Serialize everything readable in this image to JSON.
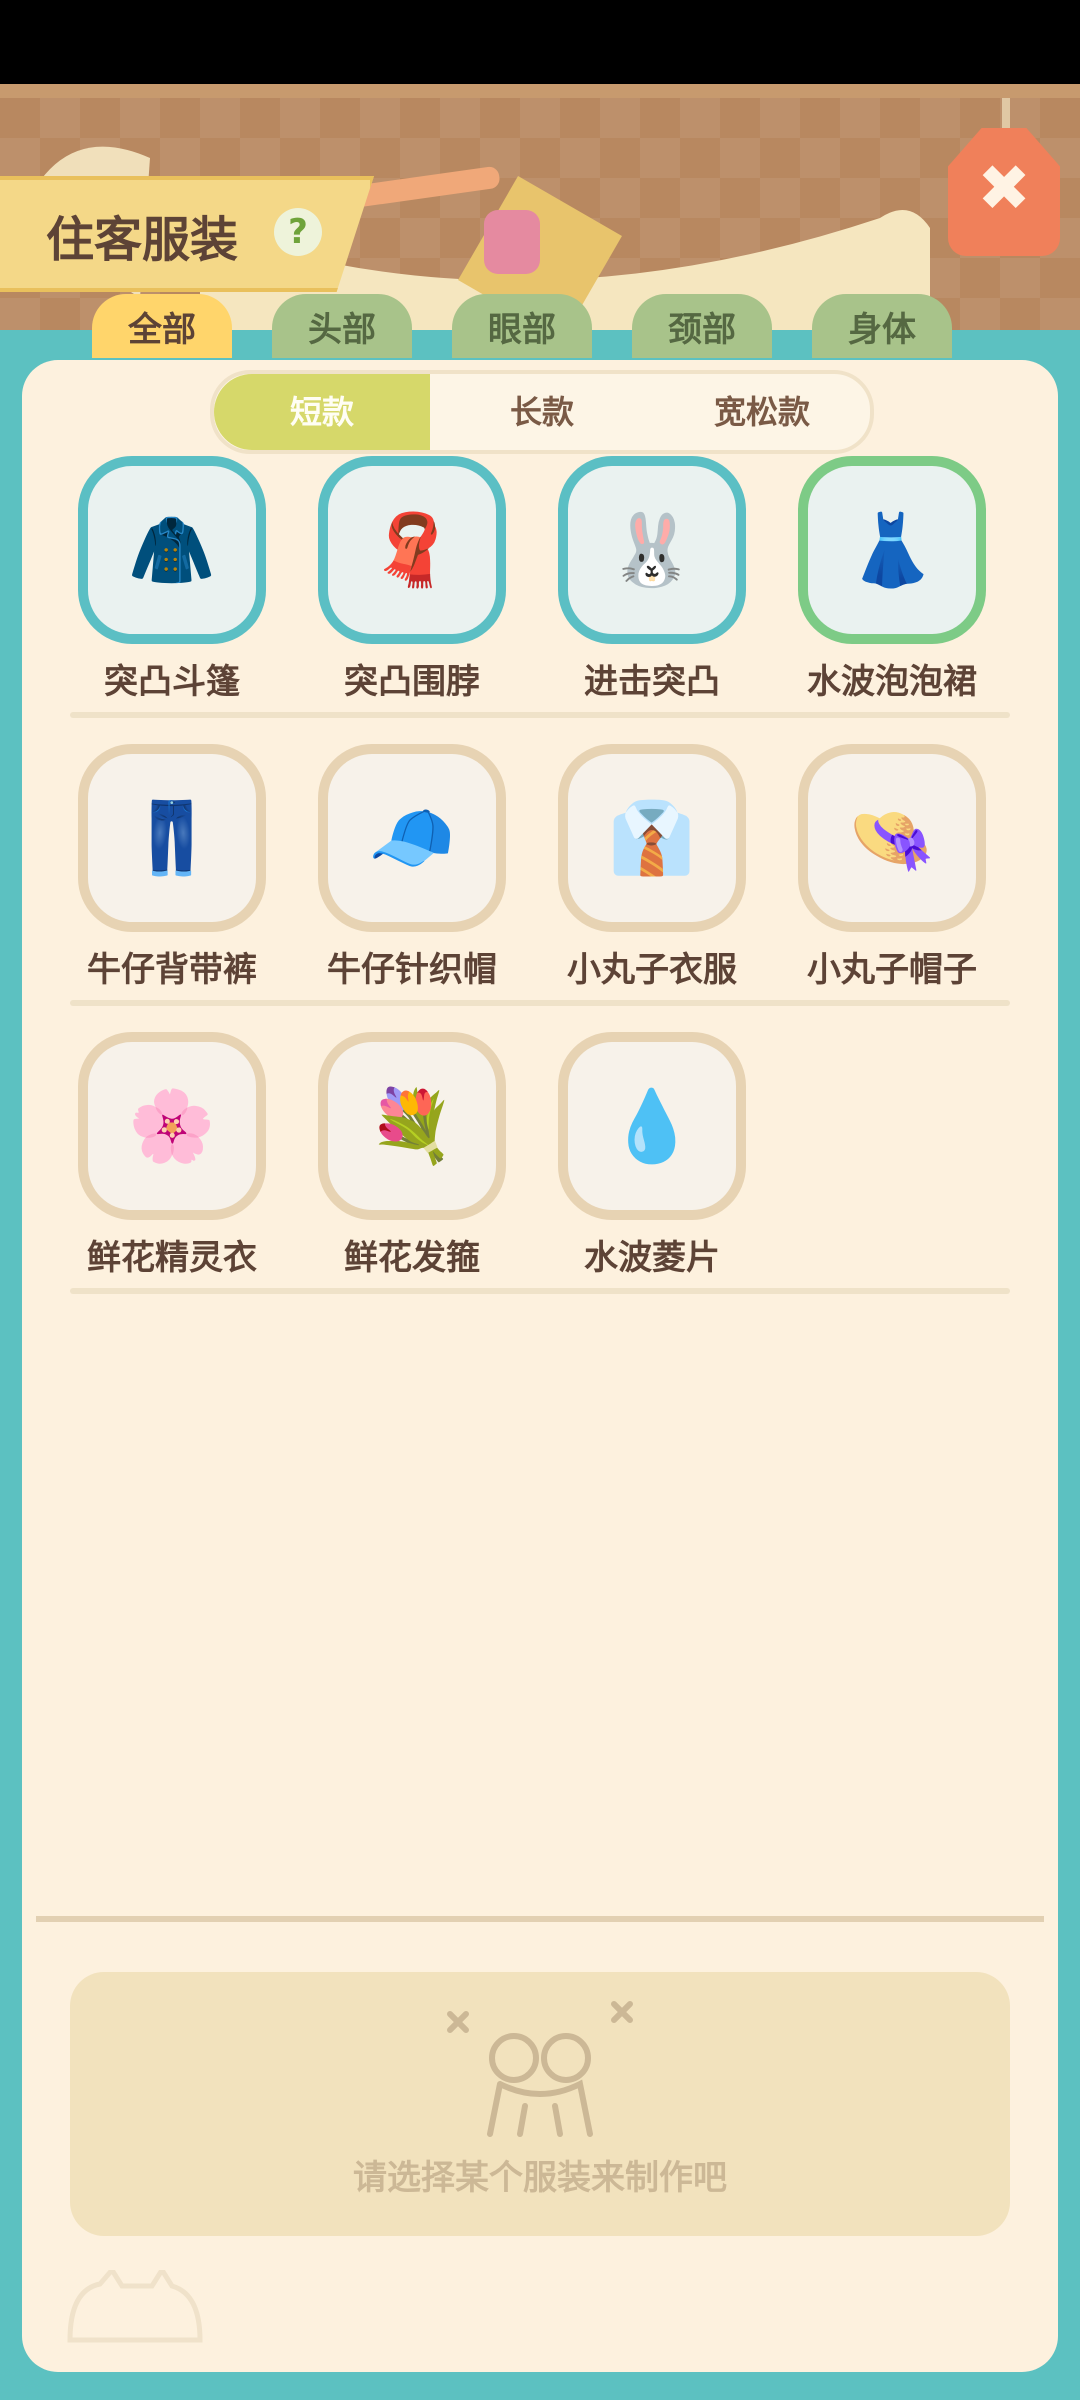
{
  "header": {
    "title": "住客服装",
    "help_glyph": "?",
    "close_glyph": "✖"
  },
  "category_tabs": [
    {
      "label": "全部",
      "active": true
    },
    {
      "label": "头部",
      "active": false
    },
    {
      "label": "眼部",
      "active": false
    },
    {
      "label": "颈部",
      "active": false
    },
    {
      "label": "身体",
      "active": false
    }
  ],
  "length_tabs": [
    {
      "label": "短款",
      "active": true
    },
    {
      "label": "长款",
      "active": false
    },
    {
      "label": "宽松款",
      "active": false
    }
  ],
  "items": [
    {
      "name": "突凸斗篷",
      "icon": "🧥",
      "state": "owned"
    },
    {
      "name": "突凸围脖",
      "icon": "🧣",
      "state": "owned"
    },
    {
      "name": "进击突凸",
      "icon": "🐰",
      "state": "owned"
    },
    {
      "name": "水波泡泡裙",
      "icon": "👗",
      "state": "selected"
    },
    {
      "name": "牛仔背带裤",
      "icon": "👖",
      "state": "normal"
    },
    {
      "name": "牛仔针织帽",
      "icon": "🧢",
      "state": "normal"
    },
    {
      "name": "小丸子衣服",
      "icon": "👔",
      "state": "normal"
    },
    {
      "name": "小丸子帽子",
      "icon": "👒",
      "state": "normal"
    },
    {
      "name": "鲜花精灵衣",
      "icon": "🌸",
      "state": "normal"
    },
    {
      "name": "鲜花发箍",
      "icon": "💐",
      "state": "normal"
    },
    {
      "name": "水波菱片",
      "icon": "💧",
      "state": "normal"
    }
  ],
  "empty_state": {
    "message": "请选择某个服装来制作吧",
    "icon": "frog-icon"
  },
  "colors": {
    "teal_frame": "#5cc1c1",
    "panel": "#fdf1de",
    "active_tab": "#ffd56b",
    "inactive_tab": "#a8c38a",
    "owned_border": "#5bbfc4",
    "selected_border": "#7dcb86"
  }
}
